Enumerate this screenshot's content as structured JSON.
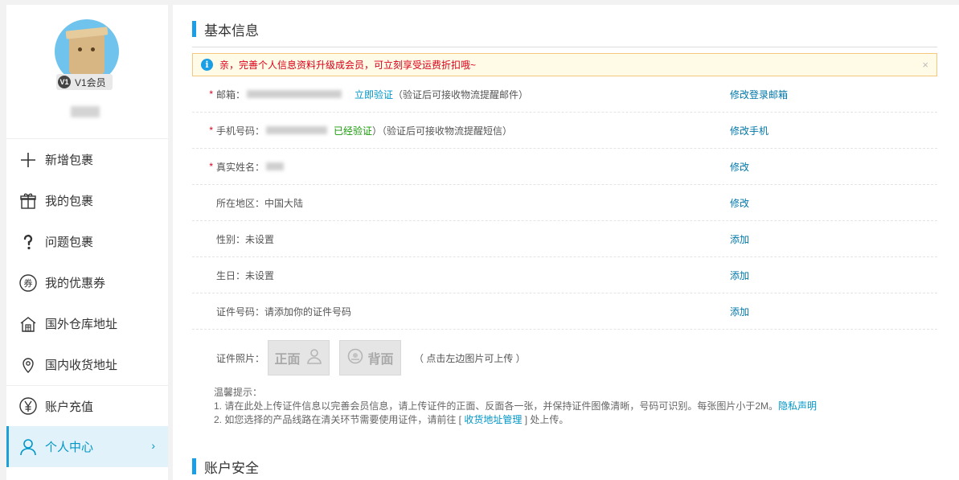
{
  "sidebar": {
    "vip_badge": "V1",
    "vip_label": "V1会员",
    "items": [
      {
        "label": "新增包裹",
        "icon": "plus-icon"
      },
      {
        "label": "我的包裹",
        "icon": "gift-icon"
      },
      {
        "label": "问题包裹",
        "icon": "question-icon"
      },
      {
        "label": "我的优惠券",
        "icon": "coupon-icon"
      },
      {
        "label": "国外仓库地址",
        "icon": "warehouse-icon"
      },
      {
        "label": "国内收货地址",
        "icon": "location-pin-icon"
      },
      {
        "label": "账户充值",
        "icon": "yen-icon"
      },
      {
        "label": "个人中心",
        "icon": "user-icon"
      }
    ],
    "chevron": "›"
  },
  "main": {
    "basic_title": "基本信息",
    "notice": "亲，完善个人信息资料升级成会员，可立刻享受运费折扣哦~",
    "notice_close": "×",
    "rows": {
      "email": {
        "label": "邮箱：",
        "verify": "立即验证",
        "hint": "（验证后可接收物流提醒邮件）",
        "action": "修改登录邮箱"
      },
      "phone": {
        "label": "手机号码：",
        "verified": "已经验证",
        "hint": "）（验证后可接收物流提醒短信）",
        "action": "修改手机"
      },
      "name": {
        "label": "真实姓名：",
        "action": "修改"
      },
      "region": {
        "label": "所在地区：中国大陆",
        "action": "修改"
      },
      "gender": {
        "label": "性别：未设置",
        "action": "添加"
      },
      "birthday": {
        "label": "生日：未设置",
        "action": "添加"
      },
      "idnum": {
        "label": "证件号码：请添加你的证件号码",
        "action": "添加"
      }
    },
    "photo": {
      "label": "证件照片：",
      "front": "正面",
      "back": "背面",
      "hint": "（ 点击左边图片可上传 ）"
    },
    "tips": {
      "title": "温馨提示：",
      "line1": "1. 请在此处上传证件信息以完善会员信息，请上传证件的正面、反面各一张，并保持证件图像清晰，号码可识别。每张图片小于2M。",
      "line1_link": "隐私声明",
      "line2_pre": "2. 如您选择的产品线路在清关环节需要使用证件，请前往 [ ",
      "line2_link": "收货地址管理",
      "line2_post": " ] 处上传。"
    },
    "security_title": "账户安全"
  },
  "colors": {
    "accent": "#1a9ee5",
    "link": "#0096c7",
    "warning": "#d9001b",
    "verified": "#1a9a0a"
  }
}
